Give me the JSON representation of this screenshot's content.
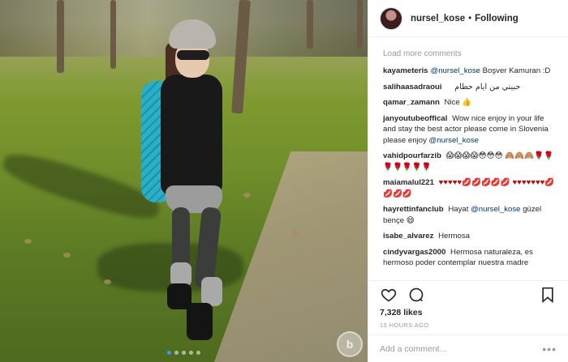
{
  "header": {
    "username": "nursel_kose",
    "separator": "•",
    "follow_label": "Following"
  },
  "comments_section": {
    "load_more_label": "Load more comments",
    "comments": [
      {
        "user": "kayameteris",
        "mention": "@nursel_kose",
        "text": " Boşver Kamuran :D"
      },
      {
        "user": "salihaasadraoui",
        "mention": "",
        "text": "حبيتي من ايام حطام"
      },
      {
        "user": "qamar_zamann",
        "mention": "",
        "text": "Nice 👍"
      },
      {
        "user": "janyoutubeoffical",
        "mention": "",
        "text": "Wow nice enjoy in your life and stay the best actor please come in Slovenia please enjoy",
        "mention_end": "@nursel_kose"
      },
      {
        "user": "vahidpourfarzib",
        "mention": "",
        "text": "😱😱😱😱😳😳😳 🙈🙈🙈🌹🌹🌹🌹🌹🌹🌹"
      },
      {
        "user": "maiamalul221",
        "mention": "",
        "text": "♥♥♥♥♥💋💋💋💋💋 ♥♥♥♥♥♥♥💋💋💋💋"
      },
      {
        "user": "hayrettinfanclub",
        "mention": "",
        "text": "Hayat",
        "mention_end": "@nursel_kose",
        "tail": " güzel bençe 😄"
      },
      {
        "user": "isabe_alvarez",
        "mention": "",
        "text": "Hermosa"
      },
      {
        "user": "cindyvargas2000",
        "mention": "",
        "text": "Hermosa naturaleza, es hermoso poder contemplar nuestra madre"
      }
    ]
  },
  "actions": {
    "like_icon": "heart-icon",
    "comment_icon": "comment-icon",
    "save_icon": "bookmark-icon"
  },
  "likes_text": "7,328 likes",
  "timestamp": "15 HOURS AGO",
  "add_comment": {
    "placeholder": "Add a comment...",
    "more_label": "•••"
  },
  "carousel": {
    "dot_count": 5,
    "active_index": 0
  },
  "colors": {
    "accent": "#3897f0",
    "mention": "#003569",
    "muted": "#999999"
  }
}
